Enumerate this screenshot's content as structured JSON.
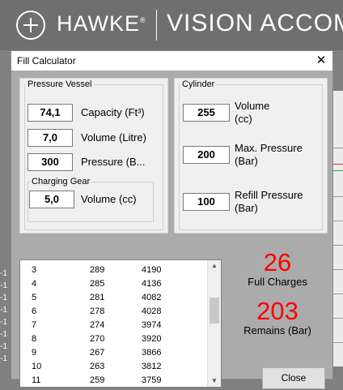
{
  "background": {
    "brand": "HAWKE",
    "brand_mark": "®",
    "section": "VISION ACCOMF",
    "left_marks": [
      "-1",
      "-1",
      "-1",
      "-1",
      "-1",
      "-1",
      "-1",
      "-1"
    ]
  },
  "dialog": {
    "title": "Fill Calculator",
    "close_glyph": "✕",
    "pressure_vessel": {
      "label": "Pressure Vessel",
      "capacity": {
        "value": "74,1",
        "label": "Capacity (Ft³)"
      },
      "volume": {
        "value": "7,0",
        "label": "Volume (Litre)"
      },
      "pressure": {
        "value": "300",
        "label": "Pressure (B..."
      },
      "charging_gear": {
        "label": "Charging Gear",
        "volume": {
          "value": "5,0",
          "label": "Volume (cc)"
        }
      }
    },
    "cylinder": {
      "label": "Cylinder",
      "volume": {
        "value": "255",
        "label_1": "Volume",
        "label_2": "(cc)"
      },
      "max_pressure": {
        "value": "200",
        "label_1": "Max. Pressure",
        "label_2": "(Bar)"
      },
      "refill_pressure": {
        "value": "100",
        "label_1": "Refill Pressure",
        "label_2": "(Bar)"
      }
    },
    "list_rows": [
      [
        "3",
        "289",
        "4190"
      ],
      [
        "4",
        "285",
        "4136"
      ],
      [
        "5",
        "281",
        "4082"
      ],
      [
        "6",
        "278",
        "4028"
      ],
      [
        "7",
        "274",
        "3974"
      ],
      [
        "8",
        "270",
        "3920"
      ],
      [
        "9",
        "267",
        "3866"
      ],
      [
        "10",
        "263",
        "3812"
      ],
      [
        "11",
        "259",
        "3759"
      ]
    ],
    "results": {
      "full_charges": "26",
      "full_charges_label": "Full Charges",
      "remains": "203",
      "remains_label": "Remains (Bar)"
    },
    "close_button": "Close"
  }
}
